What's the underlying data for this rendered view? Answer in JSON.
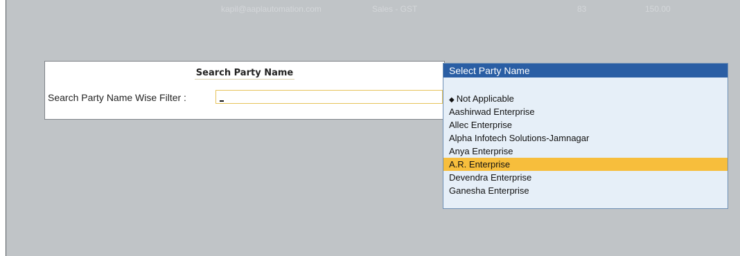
{
  "background_row": {
    "email": "kapil@aaplautomation.com",
    "voucher_type": "Sales - GST",
    "qty": "83",
    "amount": "150.00"
  },
  "search_panel": {
    "title": "Search Party Name",
    "filter_label": "Search Party Name Wise Filter :",
    "filter_value": ""
  },
  "party_list": {
    "header": "Select Party Name",
    "items": [
      "Not Applicable",
      "Aashirwad Enterprise",
      "Allec Enterprise",
      "Alpha Infotech Solutions-Jamnagar",
      "Anya Enterprise",
      "A.R. Enterprise",
      "Devendra Enterprise",
      "Ganesha Enterprise"
    ],
    "selected_item": "A.R. Enterprise"
  },
  "colors": {
    "list_header": "#2a5ea4",
    "selection": "#f7be3c",
    "list_background": "#e6eff8",
    "screen_background": "#c0c4c7"
  }
}
